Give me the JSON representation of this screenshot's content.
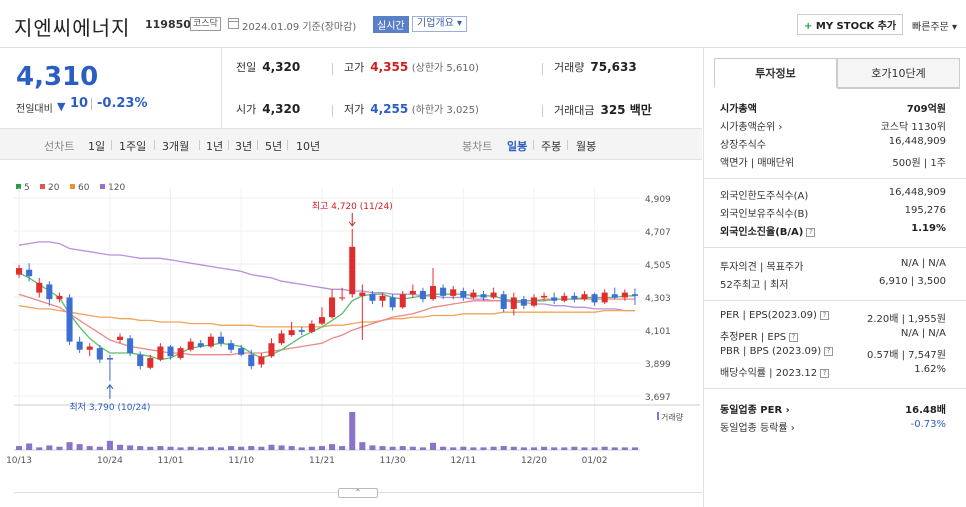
{
  "header": {
    "company": "지엔씨에너지",
    "code": "119850",
    "market": "코스닥",
    "date": "2024.01.09 기준(장마감)",
    "live": "실시간",
    "overview": "기업개요 ▾",
    "my_stock": "MY STOCK 추가",
    "my_stock_plus": "+",
    "quick_order": "빠른주문 ▾"
  },
  "price": {
    "current": "4,310",
    "change_label": "전일대비",
    "change_arrow": "▼",
    "change": "10",
    "change_pct": "-0.23%"
  },
  "stats": {
    "prev_label": "전일",
    "prev": "4,320",
    "high_label": "고가",
    "high": "4,355",
    "upper_limit": "(상한가 5,610)",
    "volume_label": "거래량",
    "volume": "75,633",
    "open_label": "시가",
    "open": "4,320",
    "low_label": "저가",
    "low": "4,255",
    "lower_limit": "(하한가 3,025)",
    "amount_label": "거래대금",
    "amount": "325 백만"
  },
  "periods": {
    "line_label": "선차트",
    "line_items": [
      "1일",
      "1주일",
      "3개월",
      "1년",
      "3년",
      "5년",
      "10년"
    ],
    "candle_label": "봉차트",
    "candle_items": [
      "일봉",
      "주봉",
      "월봉"
    ],
    "active_candle": "일봉"
  },
  "chart_data": {
    "type": "candlestick",
    "legend": [
      {
        "name": "5",
        "color": "#2a9d4a"
      },
      {
        "name": "20",
        "color": "#e05555"
      },
      {
        "name": "60",
        "color": "#e8932c"
      },
      {
        "name": "120",
        "color": "#9b6fd1"
      }
    ],
    "y_ticks": [
      "4,909",
      "4,707",
      "4,505",
      "4,303",
      "4,101",
      "3,899",
      "3,697"
    ],
    "x_ticks": [
      "10/13",
      "10/24",
      "11/01",
      "11/10",
      "11/21",
      "11/30",
      "12/11",
      "12/20",
      "01/02"
    ],
    "ylim": [
      3697,
      4909
    ],
    "high_annotation": "최고 4,720 (11/24)",
    "low_annotation": "최저 3,790 (10/24)",
    "volume_label": "거래량",
    "candles": [
      {
        "o": 4440,
        "c": 4480,
        "h": 4500,
        "l": 4420
      },
      {
        "o": 4470,
        "c": 4430,
        "h": 4510,
        "l": 4400
      },
      {
        "o": 4330,
        "c": 4390,
        "h": 4420,
        "l": 4300
      },
      {
        "o": 4380,
        "c": 4290,
        "h": 4400,
        "l": 4250
      },
      {
        "o": 4290,
        "c": 4310,
        "h": 4330,
        "l": 4270
      },
      {
        "o": 4300,
        "c": 4030,
        "h": 4320,
        "l": 4010
      },
      {
        "o": 4030,
        "c": 3980,
        "h": 4060,
        "l": 3960
      },
      {
        "o": 3980,
        "c": 4000,
        "h": 4020,
        "l": 3940
      },
      {
        "o": 3990,
        "c": 3920,
        "h": 4010,
        "l": 3900
      },
      {
        "o": 3930,
        "c": 3920,
        "h": 3950,
        "l": 3790
      },
      {
        "o": 4040,
        "c": 4060,
        "h": 4080,
        "l": 4020
      },
      {
        "o": 4050,
        "c": 3960,
        "h": 4070,
        "l": 3940
      },
      {
        "o": 3950,
        "c": 3880,
        "h": 3970,
        "l": 3860
      },
      {
        "o": 3870,
        "c": 3930,
        "h": 3950,
        "l": 3860
      },
      {
        "o": 3920,
        "c": 4000,
        "h": 4020,
        "l": 3910
      },
      {
        "o": 4000,
        "c": 3940,
        "h": 4010,
        "l": 3920
      },
      {
        "o": 3930,
        "c": 3990,
        "h": 4000,
        "l": 3920
      },
      {
        "o": 3980,
        "c": 4030,
        "h": 4050,
        "l": 3970
      },
      {
        "o": 4020,
        "c": 4000,
        "h": 4040,
        "l": 3990
      },
      {
        "o": 4000,
        "c": 4060,
        "h": 4080,
        "l": 3990
      },
      {
        "o": 4060,
        "c": 4020,
        "h": 4090,
        "l": 4000
      },
      {
        "o": 4020,
        "c": 3980,
        "h": 4040,
        "l": 3960
      },
      {
        "o": 3990,
        "c": 3950,
        "h": 4010,
        "l": 3940
      },
      {
        "o": 3950,
        "c": 3880,
        "h": 3980,
        "l": 3860
      },
      {
        "o": 3890,
        "c": 3940,
        "h": 3960,
        "l": 3870
      },
      {
        "o": 3940,
        "c": 4020,
        "h": 4050,
        "l": 3930
      },
      {
        "o": 4020,
        "c": 4080,
        "h": 4100,
        "l": 4010
      },
      {
        "o": 4070,
        "c": 4100,
        "h": 4150,
        "l": 4060
      },
      {
        "o": 4100,
        "c": 4090,
        "h": 4120,
        "l": 4070
      },
      {
        "o": 4090,
        "c": 4140,
        "h": 4160,
        "l": 4080
      },
      {
        "o": 4140,
        "c": 4180,
        "h": 4240,
        "l": 4130
      },
      {
        "o": 4180,
        "c": 4300,
        "h": 4350,
        "l": 4170
      },
      {
        "o": 4300,
        "c": 4300,
        "h": 4360,
        "l": 4280
      },
      {
        "o": 4320,
        "c": 4610,
        "h": 4720,
        "l": 4300
      },
      {
        "o": 4310,
        "c": 4330,
        "h": 4380,
        "l": 4040
      },
      {
        "o": 4320,
        "c": 4280,
        "h": 4340,
        "l": 4260
      },
      {
        "o": 4280,
        "c": 4310,
        "h": 4330,
        "l": 4240
      },
      {
        "o": 4300,
        "c": 4240,
        "h": 4320,
        "l": 4220
      },
      {
        "o": 4240,
        "c": 4320,
        "h": 4340,
        "l": 4230
      },
      {
        "o": 4320,
        "c": 4340,
        "h": 4380,
        "l": 4300
      },
      {
        "o": 4340,
        "c": 4290,
        "h": 4360,
        "l": 4270
      },
      {
        "o": 4290,
        "c": 4370,
        "h": 4480,
        "l": 4280
      },
      {
        "o": 4360,
        "c": 4310,
        "h": 4380,
        "l": 4290
      },
      {
        "o": 4310,
        "c": 4350,
        "h": 4370,
        "l": 4290
      },
      {
        "o": 4340,
        "c": 4300,
        "h": 4360,
        "l": 4280
      },
      {
        "o": 4300,
        "c": 4330,
        "h": 4350,
        "l": 4290
      },
      {
        "o": 4320,
        "c": 4300,
        "h": 4340,
        "l": 4280
      },
      {
        "o": 4300,
        "c": 4330,
        "h": 4360,
        "l": 4290
      },
      {
        "o": 4320,
        "c": 4230,
        "h": 4340,
        "l": 4210
      },
      {
        "o": 4230,
        "c": 4300,
        "h": 4330,
        "l": 4190
      },
      {
        "o": 4290,
        "c": 4250,
        "h": 4310,
        "l": 4230
      },
      {
        "o": 4250,
        "c": 4300,
        "h": 4320,
        "l": 4240
      },
      {
        "o": 4300,
        "c": 4310,
        "h": 4330,
        "l": 4280
      },
      {
        "o": 4300,
        "c": 4280,
        "h": 4330,
        "l": 4260
      },
      {
        "o": 4280,
        "c": 4310,
        "h": 4330,
        "l": 4270
      },
      {
        "o": 4310,
        "c": 4290,
        "h": 4330,
        "l": 4270
      },
      {
        "o": 4290,
        "c": 4320,
        "h": 4340,
        "l": 4280
      },
      {
        "o": 4320,
        "c": 4270,
        "h": 4330,
        "l": 4250
      },
      {
        "o": 4270,
        "c": 4330,
        "h": 4350,
        "l": 4260
      },
      {
        "o": 4320,
        "c": 4300,
        "h": 4360,
        "l": 4290
      },
      {
        "o": 4300,
        "c": 4330,
        "h": 4350,
        "l": 4280
      },
      {
        "o": 4320,
        "c": 4310,
        "h": 4355,
        "l": 4255
      }
    ],
    "ma120": [
      4620,
      4630,
      4640,
      4640,
      4630,
      4600,
      4590,
      4580,
      4570,
      4560,
      4560,
      4550,
      4540,
      4540,
      4540,
      4530,
      4520,
      4510,
      4500,
      4490,
      4480,
      4470,
      4460,
      4440,
      4430,
      4420,
      4400,
      4390,
      4380,
      4370,
      4360,
      4350,
      4350,
      4340,
      4340,
      4330,
      4330,
      4320,
      4320,
      4320,
      4310,
      4310,
      4300,
      4300,
      4300,
      4290,
      4290,
      4280,
      4280,
      4270,
      4270,
      4260,
      4260,
      4250,
      4250,
      4240,
      4240,
      4230,
      4230,
      4230,
      4220,
      4220
    ],
    "ma60": [
      4250,
      4240,
      4230,
      4230,
      4220,
      4210,
      4200,
      4190,
      4180,
      4180,
      4170,
      4170,
      4160,
      4160,
      4150,
      4150,
      4150,
      4140,
      4140,
      4140,
      4130,
      4130,
      4130,
      4130,
      4120,
      4120,
      4120,
      4120,
      4120,
      4120,
      4120,
      4130,
      4130,
      4140,
      4150,
      4150,
      4160,
      4170,
      4170,
      4180,
      4180,
      4190,
      4190,
      4190,
      4200,
      4200,
      4200,
      4200,
      4210,
      4210,
      4210,
      4210,
      4210,
      4210,
      4210,
      4210,
      4210,
      4210,
      4220,
      4220,
      4220,
      4220
    ],
    "ma20": [
      4320,
      4300,
      4280,
      4260,
      4240,
      4200,
      4160,
      4120,
      4080,
      4040,
      4020,
      4000,
      3990,
      3980,
      3970,
      3960,
      3960,
      3950,
      3950,
      3950,
      3950,
      3950,
      3960,
      3960,
      3960,
      3970,
      3980,
      3990,
      4000,
      4010,
      4020,
      4050,
      4070,
      4100,
      4120,
      4140,
      4160,
      4180,
      4190,
      4200,
      4220,
      4240,
      4250,
      4260,
      4270,
      4280,
      4280,
      4280,
      4280,
      4280,
      4280,
      4280,
      4290,
      4290,
      4290,
      4290,
      4290,
      4290,
      4290,
      4290,
      4290,
      4290
    ],
    "ma5": [
      4450,
      4420,
      4380,
      4340,
      4300,
      4200,
      4120,
      4050,
      4000,
      3960,
      3960,
      3960,
      3950,
      3940,
      3920,
      3930,
      3960,
      3990,
      4000,
      4010,
      4020,
      4010,
      4000,
      3960,
      3930,
      3950,
      3980,
      4020,
      4060,
      4090,
      4120,
      4160,
      4200,
      4280,
      4310,
      4320,
      4320,
      4300,
      4290,
      4300,
      4310,
      4320,
      4320,
      4320,
      4320,
      4310,
      4310,
      4310,
      4290,
      4280,
      4280,
      4280,
      4280,
      4290,
      4290,
      4290,
      4300,
      4300,
      4300,
      4300,
      4310,
      4310
    ],
    "volumes": [
      30,
      50,
      20,
      35,
      25,
      60,
      45,
      30,
      25,
      70,
      40,
      35,
      30,
      25,
      30,
      25,
      20,
      25,
      20,
      25,
      20,
      30,
      25,
      30,
      25,
      40,
      35,
      30,
      20,
      25,
      30,
      45,
      30,
      290,
      60,
      35,
      30,
      25,
      30,
      25,
      20,
      55,
      25,
      20,
      25,
      20,
      20,
      25,
      30,
      25,
      20,
      20,
      25,
      20,
      20,
      25,
      20,
      20,
      25,
      20,
      20,
      20
    ]
  },
  "tabs": [
    "투자정보",
    "호가10단계"
  ],
  "invest": {
    "s1": [
      {
        "l": "시가총액",
        "r": "709억원",
        "bold": true
      },
      {
        "l": "시가총액순위 ›",
        "r": "코스닥 1130위"
      },
      {
        "l": "상장주식수",
        "r": "16,448,909"
      },
      {
        "l": "액면가 | 매매단위",
        "r": "500원 | 1주"
      }
    ],
    "s2": [
      {
        "l": "외국인한도주식수(A)",
        "r": "16,448,909"
      },
      {
        "l": "외국인보유주식수(B)",
        "r": "195,276"
      },
      {
        "l": "외국인소진율(B/A)",
        "r": "1.19%",
        "bold": true,
        "q": true
      }
    ],
    "s3": [
      {
        "l": "투자의견 | 목표주가",
        "r": "N/A | N/A"
      },
      {
        "l": "52주최고 | 최저",
        "r": "6,910 | 3,500"
      }
    ],
    "s4": [
      {
        "l": "PER | EPS(2023.09)",
        "r": "2.20배 | 1,955원",
        "q": true
      },
      {
        "l": "추정PER | EPS",
        "r": "N/A | N/A",
        "q": true
      },
      {
        "l": "PBR | BPS (2023.09)",
        "r": "0.57배 | 7,547원",
        "q": true
      },
      {
        "l": "배당수익률 | 2023.12",
        "r": "1.62%",
        "q": true
      }
    ],
    "s5": [
      {
        "l": "동일업종 PER ›",
        "r": "16.48배",
        "bold": true
      },
      {
        "l": "동일업종 등락률 ›",
        "r": "-0.73%",
        "blue": true
      }
    ]
  },
  "scroll_up": "⌃"
}
